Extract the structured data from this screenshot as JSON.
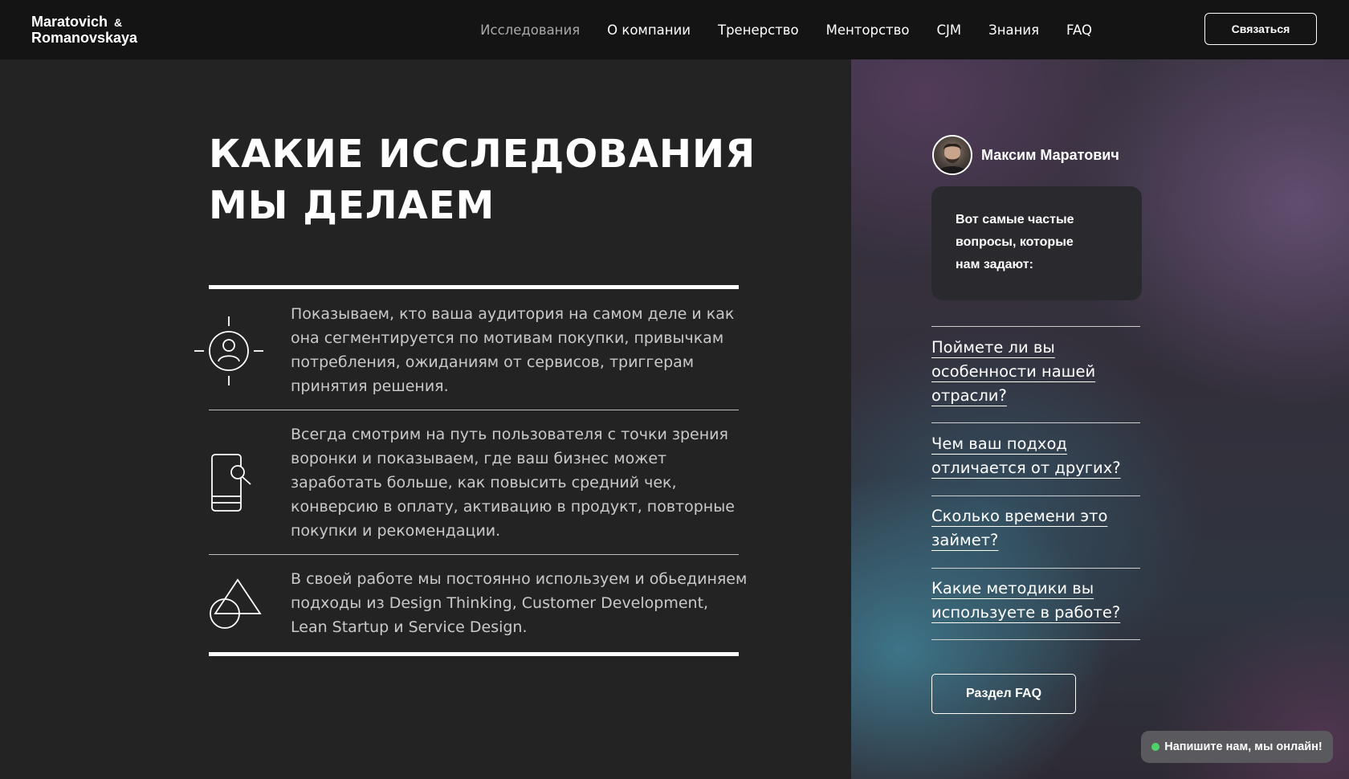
{
  "header": {
    "logo_line1": "Maratovich",
    "logo_amp": "&",
    "logo_line2": "Romanovskaya",
    "nav": [
      {
        "label": "Исследования"
      },
      {
        "label": "О компании"
      },
      {
        "label": "Тренерство"
      },
      {
        "label": "Менторство"
      },
      {
        "label": "CJM"
      },
      {
        "label": "Знания"
      },
      {
        "label": "FAQ"
      }
    ],
    "contact_label": "Связаться"
  },
  "main": {
    "title_line1": "КАКИЕ ИССЛЕДОВАНИЯ",
    "title_line2": "МЫ ДЕЛАЕМ",
    "features": [
      {
        "icon": "user-target-icon",
        "text": "Показываем, кто ваша аудитория на самом деле и как она сегментируется по мотивам покупки, привычкам потребления, ожиданиям от сервисов, триггерам принятия решения."
      },
      {
        "icon": "phone-search-icon",
        "text": "Всегда смотрим на путь пользователя с точки зрения воронки и показываем, где ваш бизнес может заработать больше, как повысить средний чек, конверсию в оплату, активацию в продукт, повторные покупки и рекомендации."
      },
      {
        "icon": "shapes-icon",
        "text": "В своей работе мы постоянно используем и обьединяем подходы из Design Thinking, Customer Development, Lean Startup и Service Design."
      }
    ]
  },
  "sidebar": {
    "author_name": "Максим Маратович",
    "bubble_text": "Вот самые частые вопросы, которые нам задают:",
    "faq": [
      {
        "label": "Поймете ли вы особенности нашей отрасли?"
      },
      {
        "label": "Чем ваш подход отличается от других?"
      },
      {
        "label": "Сколько времени это займет?"
      },
      {
        "label": "Какие методики вы используете в работе?"
      }
    ],
    "faq_button": "Раздел FAQ",
    "chat_label": "Напишите нам, мы онлайн!"
  },
  "colors": {
    "header_bg": "#141414",
    "page_bg": "#232323",
    "online_dot": "#4fd16a"
  }
}
